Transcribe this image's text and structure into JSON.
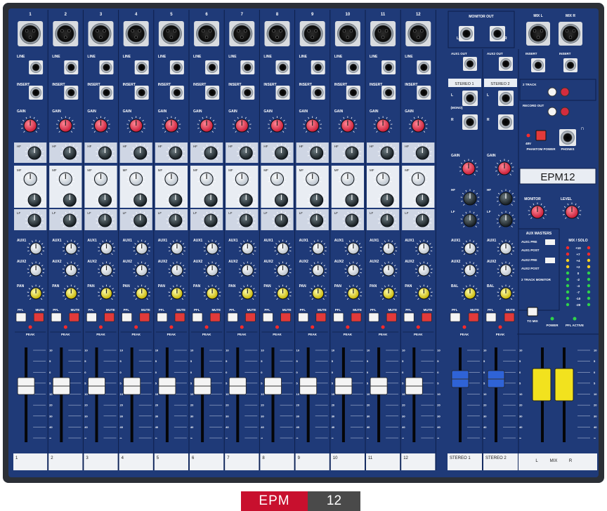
{
  "product": {
    "brand": "EPM",
    "model": "12",
    "panel_logo": "EPM12"
  },
  "channels": [
    "1",
    "2",
    "3",
    "4",
    "5",
    "6",
    "7",
    "8",
    "9",
    "10",
    "11",
    "12"
  ],
  "channel_labels": {
    "line": "LINE",
    "insert": "INSERT",
    "gain": "GAIN",
    "hf": "HF",
    "mf": "MF",
    "lf": "LF",
    "aux1": "AUX1",
    "aux2": "AUX2",
    "pan": "PAN",
    "pfl": "PFL",
    "mute": "MUTE",
    "peak": "PEAK"
  },
  "stereo": {
    "names": [
      "STEREO 1",
      "STEREO 2"
    ],
    "aux_out": [
      "AUX1 OUT",
      "AUX2 OUT"
    ],
    "mono": "(MONO)",
    "l": "L",
    "r": "R",
    "bal": "BAL"
  },
  "master": {
    "monitor_out": "MONITOR OUT",
    "mix_l": "MIX L",
    "mix_r": "MIX R",
    "insert": "INSERT",
    "two_track": "2 TRACK",
    "record_out": "RECORD OUT",
    "phantom": "PHANTOM POWER",
    "v48": "48V",
    "phones": "PHONES",
    "monitor": "MONITOR",
    "level": "LEVEL",
    "aux_masters": "AUX MASTERS",
    "aux1_pre": "AUX1 PRE",
    "aux1_post": "AUX1 POST",
    "aux2_pre": "AUX2 PRE",
    "aux2_post": "AUX2 POST",
    "two_track_to_monitor": "2 TRACK MONITOR",
    "to_mix": "TO MIX",
    "power": "POWER",
    "pfl_active": "PFL ACTIVE",
    "mix_solo": "MIX / SOLO",
    "meter_scale": [
      "+10",
      "+7",
      "+4",
      "+2",
      "0",
      "-2",
      "-4",
      "-7",
      "-10",
      "-20"
    ],
    "strip_l": "L",
    "strip_mix": "MIX",
    "strip_r": "R"
  },
  "fader_scale": [
    "10",
    "5",
    "0",
    "5",
    "10",
    "20",
    "30",
    "40",
    "∞"
  ],
  "scribble": [
    "1",
    "2",
    "3",
    "4",
    "5",
    "6",
    "7",
    "8",
    "9",
    "10",
    "11",
    "12",
    "STEREO 1",
    "STEREO 2"
  ],
  "colors": {
    "panel": "#1f3a78",
    "knob_gain": "#e8334d",
    "knob_pan": "#e6dc3a",
    "fader_mono": "#f4f4f4",
    "fader_stereo": "#2f63d6",
    "fader_master": "#f2e21e",
    "mute_button": "#e23a3a"
  }
}
